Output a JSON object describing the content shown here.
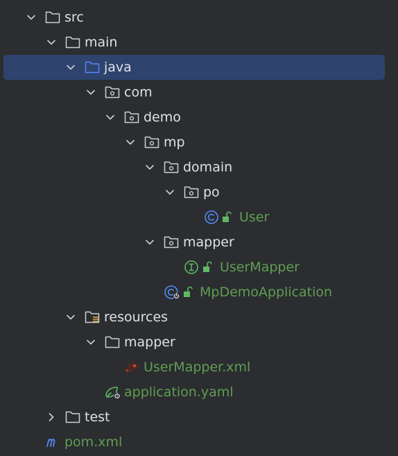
{
  "project_tree": {
    "items": [
      {
        "label": "src",
        "kind": "folder",
        "state": "expanded",
        "text_color": "#dfe1e5"
      },
      {
        "label": "main",
        "kind": "folder",
        "state": "expanded",
        "text_color": "#dfe1e5"
      },
      {
        "label": "java",
        "kind": "source-root",
        "state": "expanded",
        "selected": true,
        "text_color": "#dfe1e5"
      },
      {
        "label": "com",
        "kind": "package",
        "state": "expanded",
        "text_color": "#dfe1e5"
      },
      {
        "label": "demo",
        "kind": "package",
        "state": "expanded",
        "text_color": "#dfe1e5"
      },
      {
        "label": "mp",
        "kind": "package",
        "state": "expanded",
        "text_color": "#dfe1e5"
      },
      {
        "label": "domain",
        "kind": "package",
        "state": "expanded",
        "text_color": "#dfe1e5"
      },
      {
        "label": "po",
        "kind": "package",
        "state": "expanded",
        "text_color": "#dfe1e5"
      },
      {
        "label": "User",
        "kind": "class",
        "access": "public",
        "text_color": "#5f9e52"
      },
      {
        "label": "mapper",
        "kind": "package",
        "state": "expanded",
        "text_color": "#dfe1e5"
      },
      {
        "label": "UserMapper",
        "kind": "interface",
        "access": "public",
        "text_color": "#5f9e52"
      },
      {
        "label": "MpDemoApplication",
        "kind": "spring-boot-class",
        "access": "public",
        "text_color": "#5f9e52"
      },
      {
        "label": "resources",
        "kind": "resources-root",
        "state": "expanded",
        "text_color": "#dfe1e5"
      },
      {
        "label": "mapper",
        "kind": "folder",
        "state": "expanded",
        "text_color": "#dfe1e5"
      },
      {
        "label": "UserMapper.xml",
        "kind": "mybatis-xml-file",
        "text_color": "#5f9e52"
      },
      {
        "label": "application.yaml",
        "kind": "spring-yaml-file",
        "text_color": "#5f9e52"
      },
      {
        "label": "test",
        "kind": "folder",
        "state": "collapsed",
        "text_color": "#dfe1e5"
      },
      {
        "label": "pom.xml",
        "kind": "maven-file",
        "text_color": "#5f9e52"
      }
    ]
  },
  "colors": {
    "background": "#2b2d30",
    "selection": "#2e436e",
    "text": "#dfe1e5",
    "vcs_added_text": "#5f9e52",
    "icon_gray": "#ced0d6",
    "icon_blue": "#548af7",
    "icon_green": "#5fb865"
  }
}
